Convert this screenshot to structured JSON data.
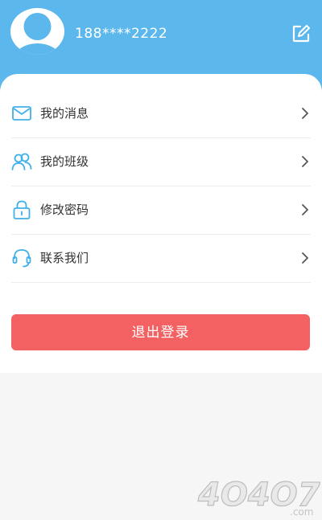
{
  "profile": {
    "phone": "188****2222",
    "avatar_icon": "default-user-avatar-icon",
    "edit_icon": "edit-icon"
  },
  "menu": {
    "items": [
      {
        "label": "我的消息",
        "icon": "mail-icon"
      },
      {
        "label": "我的班级",
        "icon": "users-icon"
      },
      {
        "label": "修改密码",
        "icon": "lock-icon"
      },
      {
        "label": "联系我们",
        "icon": "headset-icon"
      }
    ],
    "chevron_icon": "chevron-right-icon"
  },
  "logout": {
    "label": "退出登录"
  },
  "watermark": {
    "text": "4O4O7",
    "suffix": ".com"
  },
  "colors": {
    "header_bg": "#5bb7ec",
    "accent_icon": "#3fb0ea",
    "logout_bg": "#f46162",
    "page_bg": "#f6f6f6"
  }
}
